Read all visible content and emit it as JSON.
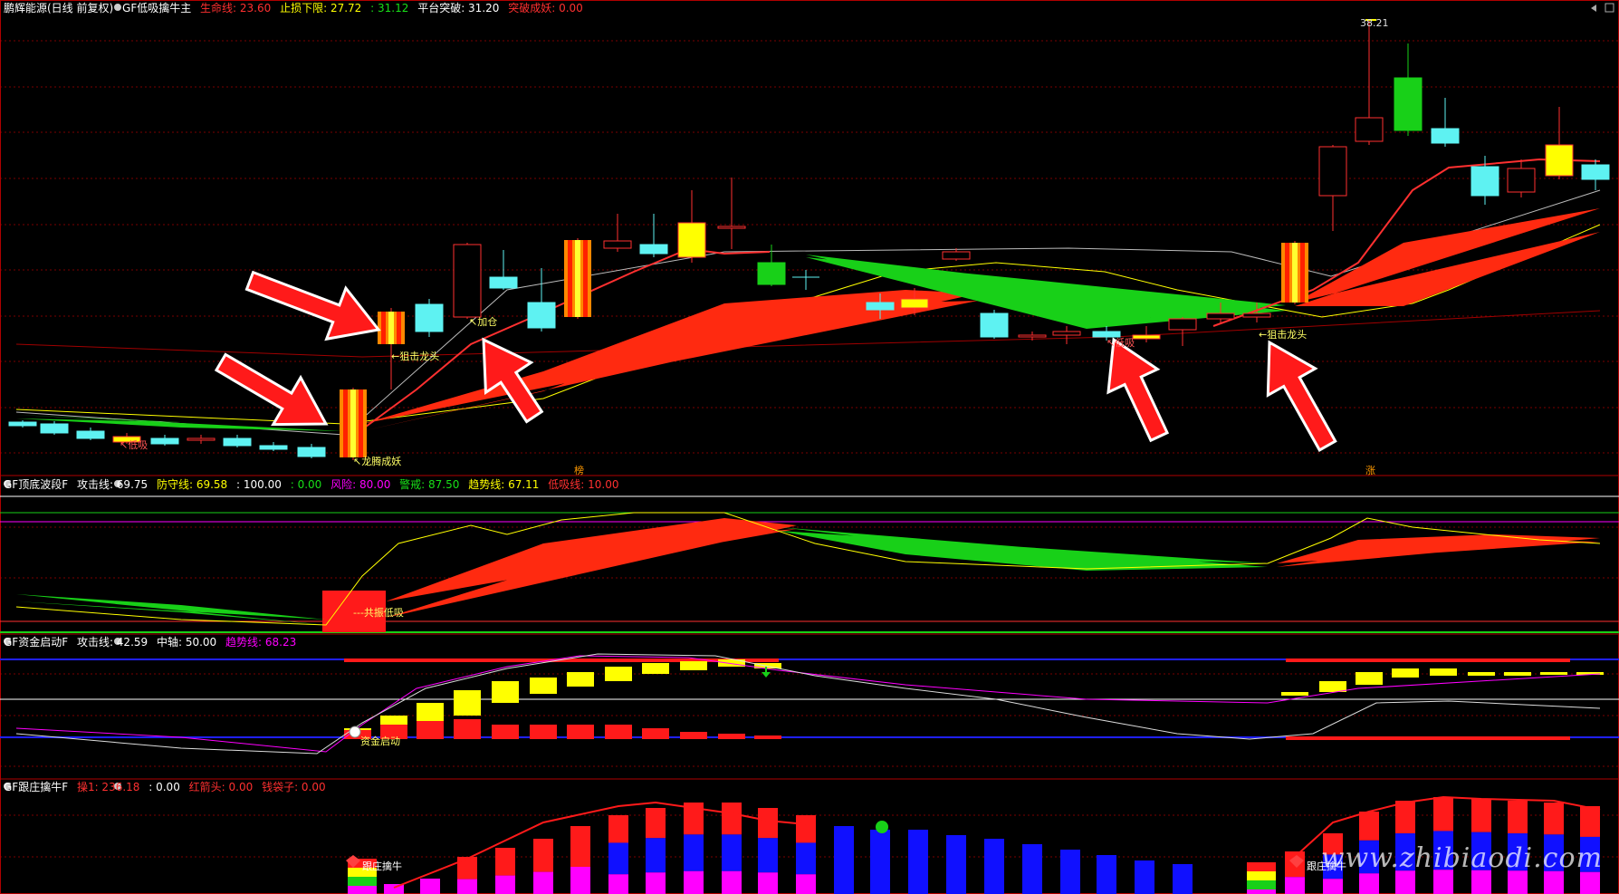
{
  "colors": {
    "bg": "#000000",
    "grid": "#7a0000",
    "up": "#ff2020",
    "down": "#5ef2f2",
    "green": "#18d018",
    "yellow": "#ffff00",
    "magenta": "#ff00ff",
    "blue": "#1010ff"
  },
  "main": {
    "stock_name": "鹏辉能源(日线 前复权)",
    "indicator": "GF低吸擒牛主",
    "values": [
      {
        "label": "生命线: 23.60",
        "color": "#ff3030"
      },
      {
        "label": "止损下限: 27.72",
        "color": "#ffff00"
      },
      {
        "label": ": 31.12",
        "color": "#18e018"
      },
      {
        "label": "平台突破: 31.20",
        "color": "#ffffff"
      },
      {
        "label": "突破成妖: 0.00",
        "color": "#ff3030"
      }
    ],
    "high_label": "38.21",
    "annotations": {
      "a1": "←狙击龙头",
      "a2": "↖加仓",
      "a3": "↖龙腾成妖",
      "a4": "↖低吸",
      "a5": "←狙击龙头",
      "a6": "↖低吸"
    },
    "bottom_tags": {
      "t1": "榜",
      "t2": "涨"
    }
  },
  "panel2": {
    "indicator": "GF顶底波段F",
    "values": [
      {
        "label": "攻击线: 69.75",
        "color": "#ffffff"
      },
      {
        "label": "防守线: 69.58",
        "color": "#ffff00"
      },
      {
        "label": ": 100.00",
        "color": "#ffffff"
      },
      {
        "label": ": 0.00",
        "color": "#18e018"
      },
      {
        "label": "风险: 80.00",
        "color": "#ff00ff"
      },
      {
        "label": "警戒: 87.50",
        "color": "#18e018"
      },
      {
        "label": "趋势线: 67.11",
        "color": "#ffff00"
      },
      {
        "label": "低吸线: 10.00",
        "color": "#ff3030"
      }
    ],
    "annotation": "---共振低吸"
  },
  "panel3": {
    "indicator": "GF资金启动F",
    "values": [
      {
        "label": "攻击线: 42.59",
        "color": "#ffffff"
      },
      {
        "label": "中轴: 50.00",
        "color": "#ffffff"
      },
      {
        "label": "趋势线: 68.23",
        "color": "#ff00ff"
      }
    ],
    "annotation": "资金启动"
  },
  "panel4": {
    "indicator": "GF跟庄擒牛F",
    "values": [
      {
        "label": "操1: 236.18",
        "color": "#ff3030"
      },
      {
        "label": ": 0.00",
        "color": "#ffffff"
      },
      {
        "label": "红箭头: 0.00",
        "color": "#ff3030"
      },
      {
        "label": "钱袋子: 0.00",
        "color": "#ff3030"
      }
    ],
    "annotations": {
      "a1": "跟庄擒牛",
      "a2": "跟庄擒牛"
    }
  },
  "watermark": "www.zhibiaodi.com"
}
